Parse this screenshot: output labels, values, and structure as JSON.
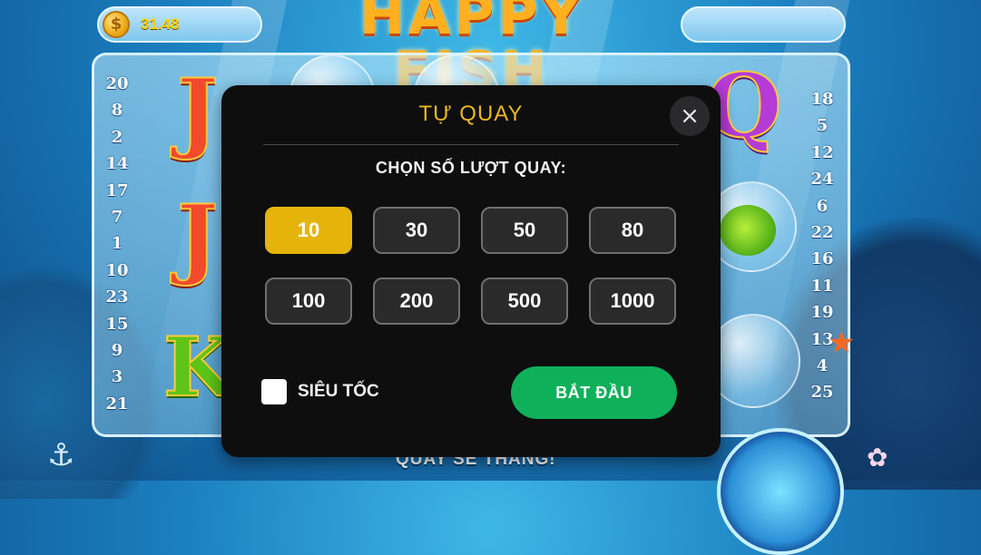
{
  "header": {
    "balance": "31.48",
    "coin_symbol": "$",
    "logo_text": "HAPPY FISH"
  },
  "reels": {
    "left_payline_numbers": [
      "20",
      "8",
      "2",
      "14",
      "17",
      "7",
      "1",
      "10",
      "23",
      "15",
      "9",
      "3",
      "21"
    ],
    "right_payline_numbers": [
      "18",
      "5",
      "12",
      "24",
      "6",
      "22",
      "16",
      "11",
      "19",
      "13",
      "4",
      "25"
    ],
    "visible_symbols": [
      "J",
      "J",
      "K",
      "Q"
    ]
  },
  "footer": {
    "banner_text": "QUAY SẼ THẮNG!"
  },
  "modal": {
    "title": "TỰ QUAY",
    "close_icon": "×",
    "subtitle": "CHỌN SỐ LƯỢT QUAY:",
    "options": [
      "10",
      "30",
      "50",
      "80",
      "100",
      "200",
      "500",
      "1000"
    ],
    "selected_option": "10",
    "turbo_label": "SIÊU TỐC",
    "turbo_checked": false,
    "start_label": "BẮT ĐẦU"
  },
  "colors": {
    "accent_gold": "#e5b40b",
    "start_green": "#0fb05a",
    "modal_bg": "#0e0e0f"
  }
}
